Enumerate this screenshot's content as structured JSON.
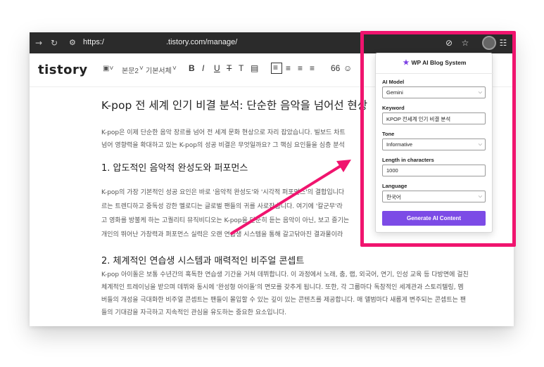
{
  "browser": {
    "url_scheme": "https:/",
    "url_host": ".tistory.com/manage/",
    "icons": [
      "back-arrow-icon",
      "reload-icon",
      "site-settings-icon",
      "eye-off-icon",
      "star-icon",
      "profile-avatar",
      "extensions-icon"
    ]
  },
  "editor": {
    "logo": "tistory",
    "tools": {
      "paragraph_style": "본문2",
      "font": "기본서체",
      "bold": "B",
      "italic": "I",
      "underline": "U",
      "strike": "T",
      "color": "T",
      "quote": "66"
    }
  },
  "article": {
    "title": "K-pop 전 세계 인기 비결 분석: 단순한 음악을 넘어선 현상",
    "intro": [
      "K-pop은 이제 단순한 음악 장르를 넘어 전 세계 문화 현상으로 자리 잡았습니다. 빌보드 차트",
      "넘어 영향력을 확대하고 있는 K-pop의 성공 비결은 무엇일까요? 그 핵심 요인들을 심층 분석"
    ],
    "section1": {
      "heading": "1. 압도적인 음악적 완성도와 퍼포먼스",
      "lines": [
        "K-pop의 가장 기본적인 성공 요인은 바로 '음악적 완성도'와 '시각적 퍼포먼스'의 결합입니다",
        "르는 트렌디하고 중독성 강한 멜로디는 글로벌 팬들의 귀를 사로잡습니다. 여기에 '칼군무'라",
        "고 영화를 방불케 하는 고퀄리티 뮤직비디오는 K-pop을 단순히 듣는 음악이 아닌, 보고 즐기는",
        "개인의 뛰어난 가창력과 퍼포먼스 실력은 오랜 연습생 시스템을 통해 갈고닦아진 결과물이라"
      ]
    },
    "section2": {
      "heading": "2. 체계적인 연습생 시스템과 매력적인 비주얼 콘셉트",
      "lines": [
        "K-pop 아이돌은 보통 수년간의 혹독한 연습생 기간을 거쳐 데뷔합니다. 이 과정에서 노래, 춤, 랩, 외국어, 연기, 인성 교육 등 다방면에 걸친",
        "체계적인 트레이닝을 받으며 데뷔와 동시에 '완성형 아이돌'의 면모를 갖추게 됩니다. 또한, 각 그룹마다 독창적인 세계관과 스토리텔링, 멤",
        "버들의 개성을 극대화한 비주얼 콘셉트는 팬들이 몰입할 수 있는 깊이 있는 콘텐츠를 제공합니다. 매 앨범마다 새롭게 변주되는 콘셉트는 팬",
        "들의 기대감을 자극하고 지속적인 관심을 유도하는 중요한 요소입니다."
      ]
    }
  },
  "popup": {
    "title": "WP AI Blog System",
    "ai_model_label": "AI Model",
    "ai_model_value": "Gemini",
    "keyword_label": "Keyword",
    "keyword_value": "KPOP 전세계 인기 비결 분석",
    "tone_label": "Tone",
    "tone_value": "Informative",
    "length_label": "Length in characters",
    "length_value": "1000",
    "language_label": "Language",
    "language_value": "한국어",
    "generate_label": "Generate AI Content"
  },
  "colors": {
    "highlight": "#f0146e",
    "arrow": "#f0146e",
    "button": "#7c4be6",
    "topbar": "#2b2b2b"
  }
}
